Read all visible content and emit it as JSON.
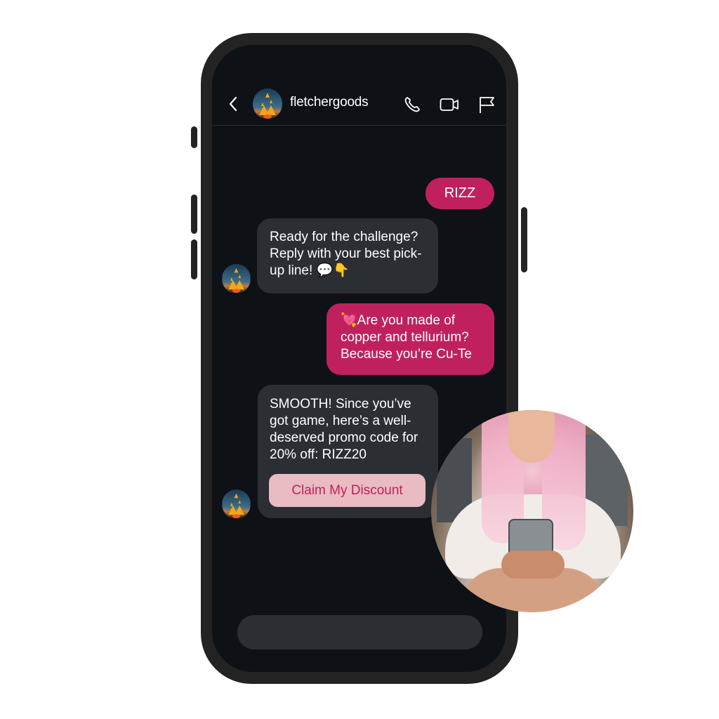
{
  "header": {
    "contact_name": "fletchergoods",
    "icons": [
      "back-icon",
      "phone-icon",
      "video-camera-icon",
      "flag-icon"
    ]
  },
  "messages": [
    {
      "direction": "sent",
      "text": "RIZZ"
    },
    {
      "direction": "received",
      "text": "Ready for the challenge? Reply with your best pick-up line! 💬👇"
    },
    {
      "direction": "sent",
      "text": "💘Are you made of copper and tellurium? Because you’re Cu-Te"
    },
    {
      "direction": "received",
      "text": "SMOOTH! Since you’ve got game, here’s a well-deserved promo code for 20% off: RIZZ20",
      "button_label": "Claim My Discount"
    }
  ],
  "composer": {
    "placeholder": ""
  },
  "colors": {
    "accent": "#c0205e",
    "received_bubble": "#2b2e33",
    "screen_bg": "#0e1116",
    "button_bg": "#e8bcc2"
  }
}
